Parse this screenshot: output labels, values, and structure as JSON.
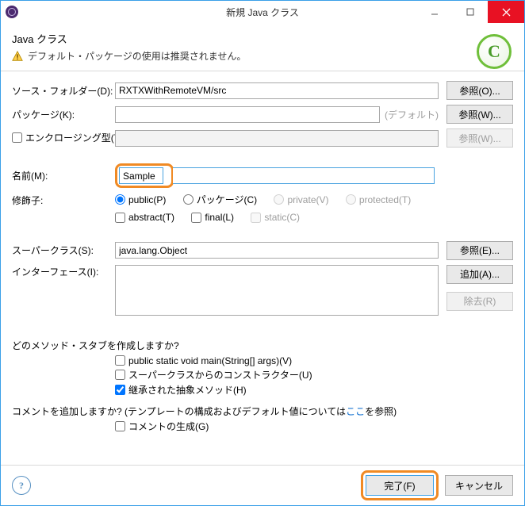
{
  "window": {
    "title": "新規 Java クラス"
  },
  "banner": {
    "title": "Java クラス",
    "warning": "デフォルト・パッケージの使用は推奨されません。"
  },
  "labels": {
    "source_folder": "ソース・フォルダー(D):",
    "package": "パッケージ(K):",
    "enclosing_type": "エンクロージング型(Y):",
    "name": "名前(M):",
    "modifier": "修飾子:",
    "superclass": "スーパークラス(S):",
    "interfaces": "インターフェース(I):"
  },
  "fields": {
    "source_folder": "RXTXWithRemoteVM/src",
    "package": "",
    "package_hint": "(デフォルト)",
    "enclosing_type": "",
    "name": "Sample",
    "superclass": "java.lang.Object",
    "interfaces": ""
  },
  "modifiers": {
    "public": "public(P)",
    "package": "パッケージ(C)",
    "private": "private(V)",
    "protected": "protected(T)",
    "abstract": "abstract(T)",
    "final": "final(L)",
    "static": "static(C)"
  },
  "buttons": {
    "browse_o": "参照(O)...",
    "browse_w": "参照(W)...",
    "browse_w2": "参照(W)...",
    "browse_e": "参照(E)...",
    "add_a": "追加(A)...",
    "remove_r": "除去(R)",
    "finish": "完了(F)",
    "cancel": "キャンセル"
  },
  "stubs": {
    "question": "どのメソッド・スタブを作成しますか?",
    "main": "public static void main(String[] args)(V)",
    "super_ctor": "スーパークラスからのコンストラクター(U)",
    "inherited": "継承された抽象メソッド(H)"
  },
  "comments": {
    "question_pre": "コメントを追加しますか? (テンプレートの構成およびデフォルト値については",
    "link": "ここ",
    "question_post": "を参照)",
    "generate": "コメントの生成(G)"
  }
}
